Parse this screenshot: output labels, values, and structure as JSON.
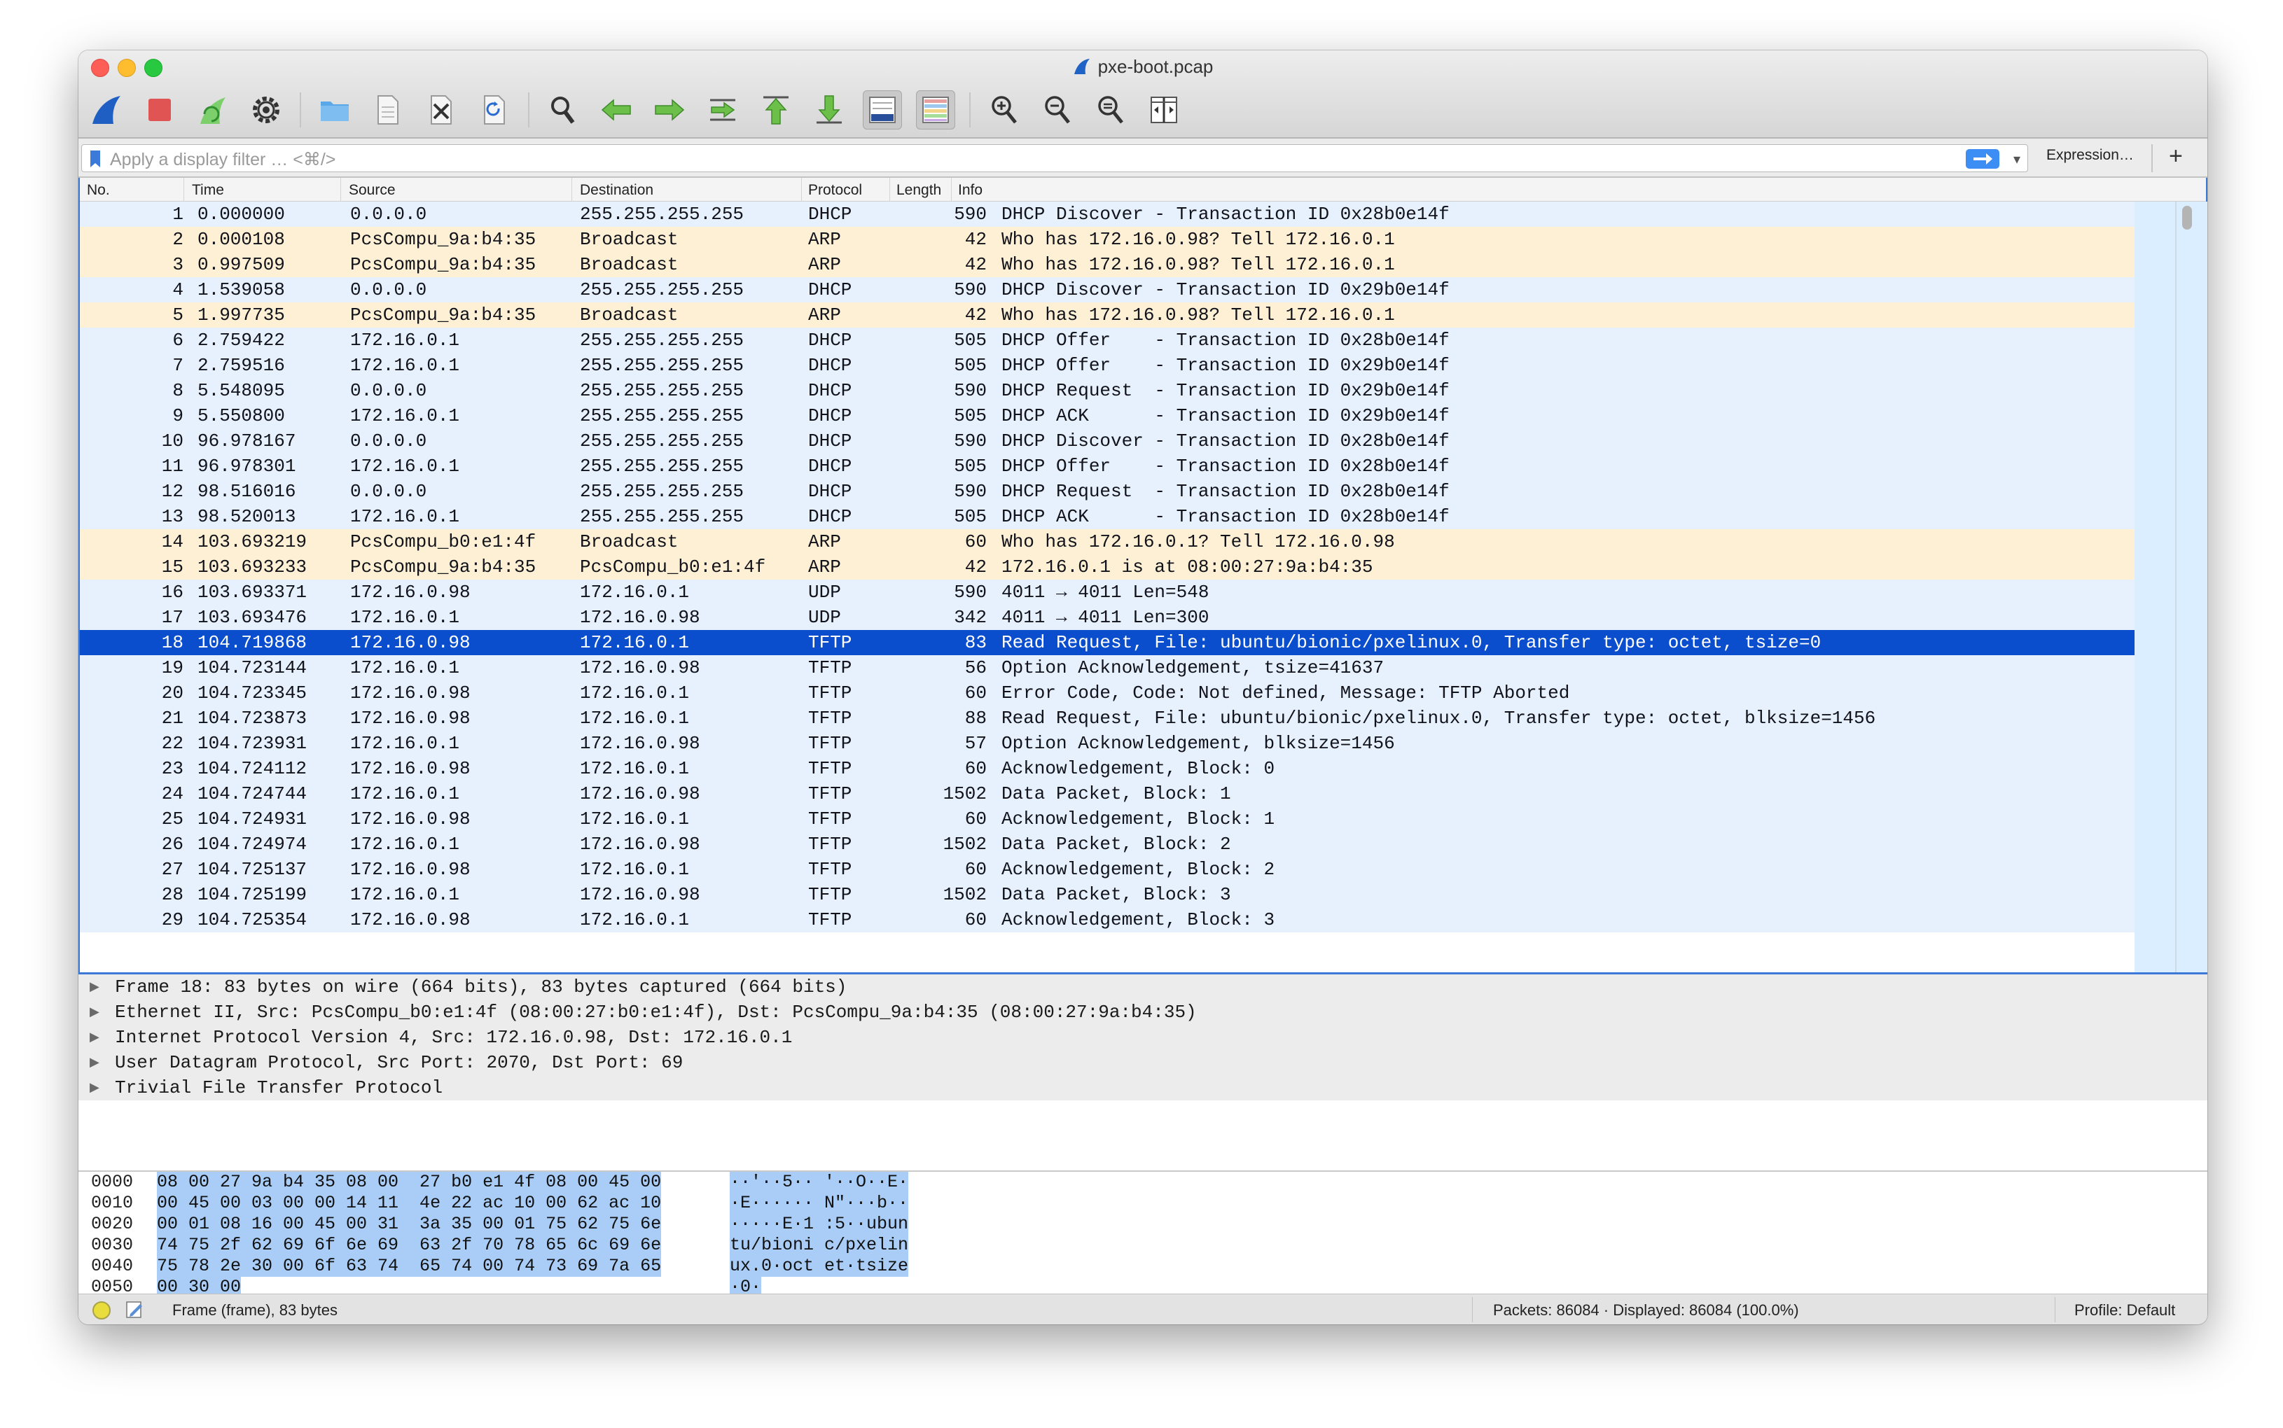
{
  "window": {
    "title": "pxe-boot.pcap"
  },
  "toolbar": {
    "buttons": [
      {
        "name": "start-capture",
        "icon": "shark-fin-icon"
      },
      {
        "name": "stop-capture",
        "icon": "stop-icon"
      },
      {
        "name": "restart-capture",
        "icon": "restart-fin-icon"
      },
      {
        "name": "capture-options",
        "icon": "gear-icon"
      },
      {
        "name": "open-file",
        "icon": "folder-icon"
      },
      {
        "name": "save-file",
        "icon": "document-icon"
      },
      {
        "name": "close-file",
        "icon": "close-file-icon"
      },
      {
        "name": "reload-file",
        "icon": "reload-icon"
      },
      {
        "name": "find-packet",
        "icon": "magnifier-icon"
      },
      {
        "name": "go-back",
        "icon": "arrow-left-icon"
      },
      {
        "name": "go-forward",
        "icon": "arrow-right-icon"
      },
      {
        "name": "go-to-packet",
        "icon": "jump-icon"
      },
      {
        "name": "go-first",
        "icon": "arrow-up-icon"
      },
      {
        "name": "go-last",
        "icon": "arrow-down-icon"
      },
      {
        "name": "autoscroll",
        "icon": "autoscroll-icon"
      },
      {
        "name": "colorize",
        "icon": "colorize-icon"
      },
      {
        "name": "zoom-in",
        "icon": "zoom-in-icon"
      },
      {
        "name": "zoom-out",
        "icon": "zoom-out-icon"
      },
      {
        "name": "normal-size",
        "icon": "zoom-normal-icon"
      },
      {
        "name": "resize-columns",
        "icon": "resize-columns-icon"
      }
    ]
  },
  "filter": {
    "placeholder": "Apply a display filter … <⌘/>",
    "expression_label": "Expression…",
    "add_label": "+"
  },
  "columns": [
    "No.",
    "Time",
    "Source",
    "Destination",
    "Protocol",
    "Length",
    "Info"
  ],
  "colors": {
    "row_blue": "#e7f1fe",
    "row_orange": "#fdf0d5",
    "row_selected": "#0a4ece",
    "accent": "#3c78d8"
  },
  "packets": [
    {
      "no": "1",
      "time": "0.000000",
      "src": "0.0.0.0",
      "dst": "255.255.255.255",
      "proto": "DHCP",
      "len": "590",
      "info": "DHCP Discover - Transaction ID 0x28b0e14f"
    },
    {
      "no": "2",
      "time": "0.000108",
      "src": "PcsCompu_9a:b4:35",
      "dst": "Broadcast",
      "proto": "ARP",
      "len": "42",
      "info": "Who has 172.16.0.98? Tell 172.16.0.1"
    },
    {
      "no": "3",
      "time": "0.997509",
      "src": "PcsCompu_9a:b4:35",
      "dst": "Broadcast",
      "proto": "ARP",
      "len": "42",
      "info": "Who has 172.16.0.98? Tell 172.16.0.1"
    },
    {
      "no": "4",
      "time": "1.539058",
      "src": "0.0.0.0",
      "dst": "255.255.255.255",
      "proto": "DHCP",
      "len": "590",
      "info": "DHCP Discover - Transaction ID 0x29b0e14f"
    },
    {
      "no": "5",
      "time": "1.997735",
      "src": "PcsCompu_9a:b4:35",
      "dst": "Broadcast",
      "proto": "ARP",
      "len": "42",
      "info": "Who has 172.16.0.98? Tell 172.16.0.1"
    },
    {
      "no": "6",
      "time": "2.759422",
      "src": "172.16.0.1",
      "dst": "255.255.255.255",
      "proto": "DHCP",
      "len": "505",
      "info": "DHCP Offer    - Transaction ID 0x28b0e14f"
    },
    {
      "no": "7",
      "time": "2.759516",
      "src": "172.16.0.1",
      "dst": "255.255.255.255",
      "proto": "DHCP",
      "len": "505",
      "info": "DHCP Offer    - Transaction ID 0x29b0e14f"
    },
    {
      "no": "8",
      "time": "5.548095",
      "src": "0.0.0.0",
      "dst": "255.255.255.255",
      "proto": "DHCP",
      "len": "590",
      "info": "DHCP Request  - Transaction ID 0x29b0e14f"
    },
    {
      "no": "9",
      "time": "5.550800",
      "src": "172.16.0.1",
      "dst": "255.255.255.255",
      "proto": "DHCP",
      "len": "505",
      "info": "DHCP ACK      - Transaction ID 0x29b0e14f"
    },
    {
      "no": "10",
      "time": "96.978167",
      "src": "0.0.0.0",
      "dst": "255.255.255.255",
      "proto": "DHCP",
      "len": "590",
      "info": "DHCP Discover - Transaction ID 0x28b0e14f"
    },
    {
      "no": "11",
      "time": "96.978301",
      "src": "172.16.0.1",
      "dst": "255.255.255.255",
      "proto": "DHCP",
      "len": "505",
      "info": "DHCP Offer    - Transaction ID 0x28b0e14f"
    },
    {
      "no": "12",
      "time": "98.516016",
      "src": "0.0.0.0",
      "dst": "255.255.255.255",
      "proto": "DHCP",
      "len": "590",
      "info": "DHCP Request  - Transaction ID 0x28b0e14f"
    },
    {
      "no": "13",
      "time": "98.520013",
      "src": "172.16.0.1",
      "dst": "255.255.255.255",
      "proto": "DHCP",
      "len": "505",
      "info": "DHCP ACK      - Transaction ID 0x28b0e14f"
    },
    {
      "no": "14",
      "time": "103.693219",
      "src": "PcsCompu_b0:e1:4f",
      "dst": "Broadcast",
      "proto": "ARP",
      "len": "60",
      "info": "Who has 172.16.0.1? Tell 172.16.0.98"
    },
    {
      "no": "15",
      "time": "103.693233",
      "src": "PcsCompu_9a:b4:35",
      "dst": "PcsCompu_b0:e1:4f",
      "proto": "ARP",
      "len": "42",
      "info": "172.16.0.1 is at 08:00:27:9a:b4:35"
    },
    {
      "no": "16",
      "time": "103.693371",
      "src": "172.16.0.98",
      "dst": "172.16.0.1",
      "proto": "UDP",
      "len": "590",
      "info": "4011 → 4011 Len=548"
    },
    {
      "no": "17",
      "time": "103.693476",
      "src": "172.16.0.1",
      "dst": "172.16.0.98",
      "proto": "UDP",
      "len": "342",
      "info": "4011 → 4011 Len=300"
    },
    {
      "no": "18",
      "time": "104.719868",
      "src": "172.16.0.98",
      "dst": "172.16.0.1",
      "proto": "TFTP",
      "len": "83",
      "info": "Read Request, File: ubuntu/bionic/pxelinux.0, Transfer type: octet, tsize=0",
      "selected": true
    },
    {
      "no": "19",
      "time": "104.723144",
      "src": "172.16.0.1",
      "dst": "172.16.0.98",
      "proto": "TFTP",
      "len": "56",
      "info": "Option Acknowledgement, tsize=41637"
    },
    {
      "no": "20",
      "time": "104.723345",
      "src": "172.16.0.98",
      "dst": "172.16.0.1",
      "proto": "TFTP",
      "len": "60",
      "info": "Error Code, Code: Not defined, Message: TFTP Aborted"
    },
    {
      "no": "21",
      "time": "104.723873",
      "src": "172.16.0.98",
      "dst": "172.16.0.1",
      "proto": "TFTP",
      "len": "88",
      "info": "Read Request, File: ubuntu/bionic/pxelinux.0, Transfer type: octet, blksize=1456"
    },
    {
      "no": "22",
      "time": "104.723931",
      "src": "172.16.0.1",
      "dst": "172.16.0.98",
      "proto": "TFTP",
      "len": "57",
      "info": "Option Acknowledgement, blksize=1456"
    },
    {
      "no": "23",
      "time": "104.724112",
      "src": "172.16.0.98",
      "dst": "172.16.0.1",
      "proto": "TFTP",
      "len": "60",
      "info": "Acknowledgement, Block: 0"
    },
    {
      "no": "24",
      "time": "104.724744",
      "src": "172.16.0.1",
      "dst": "172.16.0.98",
      "proto": "TFTP",
      "len": "1502",
      "info": "Data Packet, Block: 1"
    },
    {
      "no": "25",
      "time": "104.724931",
      "src": "172.16.0.98",
      "dst": "172.16.0.1",
      "proto": "TFTP",
      "len": "60",
      "info": "Acknowledgement, Block: 1"
    },
    {
      "no": "26",
      "time": "104.724974",
      "src": "172.16.0.1",
      "dst": "172.16.0.98",
      "proto": "TFTP",
      "len": "1502",
      "info": "Data Packet, Block: 2"
    },
    {
      "no": "27",
      "time": "104.725137",
      "src": "172.16.0.98",
      "dst": "172.16.0.1",
      "proto": "TFTP",
      "len": "60",
      "info": "Acknowledgement, Block: 2"
    },
    {
      "no": "28",
      "time": "104.725199",
      "src": "172.16.0.1",
      "dst": "172.16.0.98",
      "proto": "TFTP",
      "len": "1502",
      "info": "Data Packet, Block: 3"
    },
    {
      "no": "29",
      "time": "104.725354",
      "src": "172.16.0.98",
      "dst": "172.16.0.1",
      "proto": "TFTP",
      "len": "60",
      "info": "Acknowledgement, Block: 3"
    }
  ],
  "details": [
    "Frame 18: 83 bytes on wire (664 bits), 83 bytes captured (664 bits)",
    "Ethernet II, Src: PcsCompu_b0:e1:4f (08:00:27:b0:e1:4f), Dst: PcsCompu_9a:b4:35 (08:00:27:9a:b4:35)",
    "Internet Protocol Version 4, Src: 172.16.0.98, Dst: 172.16.0.1",
    "User Datagram Protocol, Src Port: 2070, Dst Port: 69",
    "Trivial File Transfer Protocol"
  ],
  "hexdump": [
    {
      "offset": "0000",
      "hex": "08 00 27 9a b4 35 08 00  27 b0 e1 4f 08 00 45 00",
      "ascii": "··'··5·· '··O··E·"
    },
    {
      "offset": "0010",
      "hex": "00 45 00 03 00 00 14 11  4e 22 ac 10 00 62 ac 10",
      "ascii": "·E······ N\"···b··"
    },
    {
      "offset": "0020",
      "hex": "00 01 08 16 00 45 00 31  3a 35 00 01 75 62 75 6e",
      "ascii": "·····E·1 :5··ubun"
    },
    {
      "offset": "0030",
      "hex": "74 75 2f 62 69 6f 6e 69  63 2f 70 78 65 6c 69 6e",
      "ascii": "tu/bioni c/pxelin"
    },
    {
      "offset": "0040",
      "hex": "75 78 2e 30 00 6f 63 74  65 74 00 74 73 69 7a 65",
      "ascii": "ux.0·oct et·tsize"
    },
    {
      "offset": "0050",
      "hex": "00 30 00",
      "ascii": "·0·"
    }
  ],
  "status": {
    "frame_text": "Frame (frame), 83 bytes",
    "packets_text": "Packets: 86084 · Displayed: 86084 (100.0%)",
    "profile_text": "Profile: Default"
  }
}
